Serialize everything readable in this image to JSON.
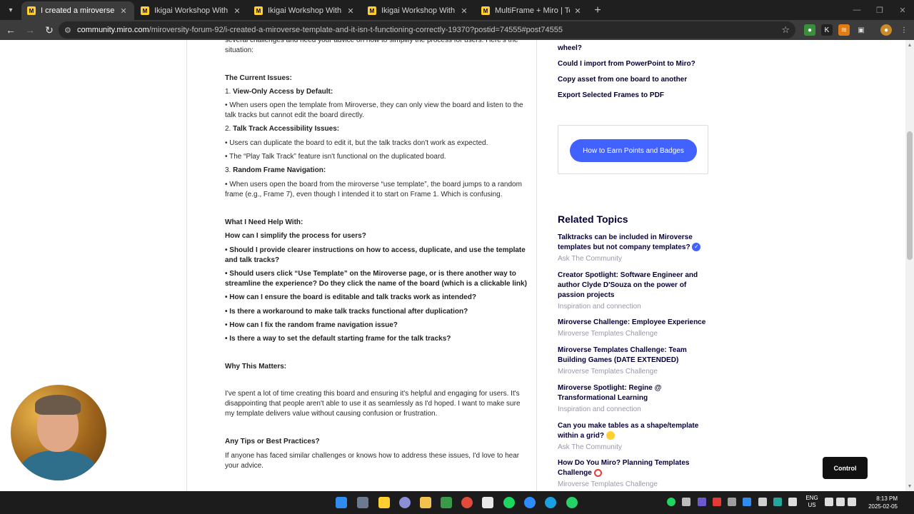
{
  "tabs": [
    {
      "title": "I created a miroverse template a",
      "active": true
    },
    {
      "title": "Ikigai Workshop With Video Su",
      "active": false
    },
    {
      "title": "Ikigai Workshop With Video Su",
      "active": false
    },
    {
      "title": "Ikigai Workshop With Video Su",
      "active": false
    },
    {
      "title": "MultiFrame + Miro | Team Colla",
      "active": false
    }
  ],
  "address_bar": {
    "host": "community.miro.com",
    "path": "/miroversity-forum-92/i-created-a-miroverse-template-and-it-isn-t-functioning-correctly-19370?postid=74555#post74555"
  },
  "post": {
    "intro": "several challenges and need your advice on how to simplify the process for users. Here's the situation:",
    "current_issues_heading": "The Current Issues:",
    "issue1_num": "1.",
    "issue1_title": "View-Only Access by Default:",
    "issue1_text": "• When users open the template from Miroverse, they can only view the board and listen to the talk tracks but cannot edit the board directly.",
    "issue2_num": "2.",
    "issue2_title": "Talk Track Accessibility Issues:",
    "issue2_text_a": "• Users can duplicate the board to edit it, but the talk tracks don't work as expected.",
    "issue2_text_b": "• The “Play Talk Track” feature isn't functional on the duplicated board.",
    "issue3_num": "3.",
    "issue3_title": "Random Frame Navigation:",
    "issue3_text": "• When users open the board from the miroverse “use template”, the board jumps to a random frame (e.g., Frame 7), even though I intended it to start on Frame 1. Which is confusing.",
    "help_heading": "What I Need Help With:",
    "help_q1": "How can I simplify the process for users?",
    "help_b1": "• Should I provide clearer instructions on how to access, duplicate, and use the template and talk tracks?",
    "help_b2": "• Should users click “Use Template” on the Miroverse page, or is there another way to streamline the experience? Do they click the name of the board (which is a clickable link)",
    "help_b3": "• How can I ensure the board is editable and talk tracks work as intended?",
    "help_b4": " • Is there a workaround to make talk tracks functional after duplication?",
    "help_b5": "• How can I fix the random frame navigation issue?",
    "help_b6": "• Is there a way to set the default starting frame for the talk tracks?",
    "why_heading": "Why This Matters:",
    "why_text": "I've spent a lot of time creating this board and ensuring it's helpful and engaging for users. It's disappointing that people aren't able to use it as seamlessly as I'd hoped. I want to make sure my template delivers value without causing confusion or frustration.",
    "tips_heading": "Any Tips or Best Practices?",
    "tips_text": "If anyone has faced similar challenges or knows how to address these issues, I'd love to hear your advice."
  },
  "sidebar": {
    "links": [
      "wheel?",
      "Could I import from PowerPoint to Miro?",
      "Copy asset from one board to another",
      "Export Selected Frames to PDF"
    ],
    "badges_button": "How to Earn Points and Badges",
    "related_heading": "Related Topics",
    "topics": [
      {
        "title": "Talktracks can be included in Miroverse templates but not company templates?",
        "category": "Ask The Community"
      },
      {
        "title": "Creator Spotlight: Software Engineer and author Clyde D'Souza on the power of passion projects",
        "category": "Inspiration and connection"
      },
      {
        "title": "Miroverse Challenge: Employee Experience",
        "category": "Miroverse Templates Challenge"
      },
      {
        "title": "Miroverse Templates Challenge: Team Building Games (DATE EXTENDED)",
        "category": "Miroverse Templates Challenge"
      },
      {
        "title": "Miroverse Spotlight: Regine @ Transformational Learning",
        "category": "Inspiration and connection"
      },
      {
        "title": "Can you make tables as a shape/template within a grid?",
        "category": "Ask The Community"
      },
      {
        "title": "How Do You Miro? Planning Templates Challenge",
        "category": "Miroverse Templates Challenge"
      }
    ]
  },
  "overlay": {
    "control_label": "Control"
  },
  "taskbar": {
    "lang": "ENG",
    "region": "US",
    "time": "8:13 PM",
    "date": "2025-02-05"
  },
  "colors": {
    "miro_yellow": "#ffd02f",
    "miro_blue": "#4262ff",
    "miro_navy": "#050038"
  }
}
